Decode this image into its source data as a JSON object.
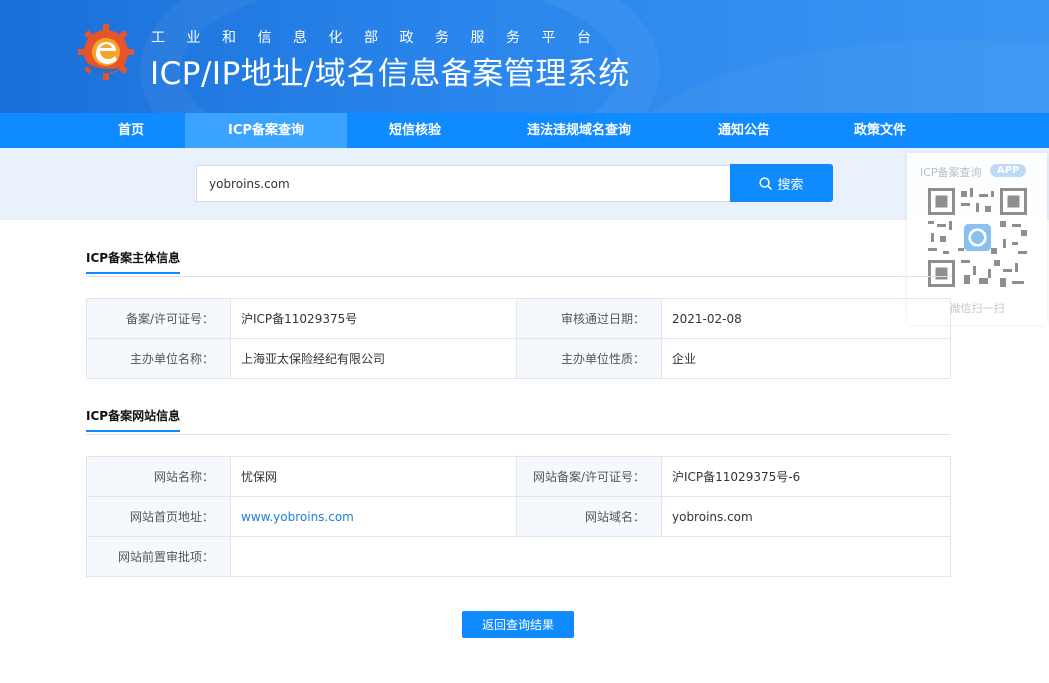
{
  "header": {
    "subtitle": "工业和信息化部政务服务平台",
    "title": "ICP/IP地址/域名信息备案管理系统"
  },
  "nav": {
    "items": [
      {
        "label": "首页"
      },
      {
        "label": "ICP备案查询",
        "active": true
      },
      {
        "label": "短信核验"
      },
      {
        "label": "违法违规域名查询"
      },
      {
        "label": "通知公告"
      },
      {
        "label": "政策文件"
      }
    ]
  },
  "search": {
    "value": "yobroins.com",
    "button_label": "搜索"
  },
  "qr_card": {
    "title": "ICP备案查询",
    "badge": "APP",
    "caption": "微信扫一扫"
  },
  "subject_section": {
    "title": "ICP备案主体信息",
    "rows": [
      {
        "label1": "备案/许可证号：",
        "value1": "沪ICP备11029375号",
        "label2": "审核通过日期：",
        "value2": "2021-02-08"
      },
      {
        "label1": "主办单位名称：",
        "value1": "上海亚太保险经纪有限公司",
        "label2": "主办单位性质：",
        "value2": "企业"
      }
    ]
  },
  "website_section": {
    "title": "ICP备案网站信息",
    "site_name_label": "网站名称：",
    "site_name": "忧保网",
    "site_license_label": "网站备案/许可证号：",
    "site_license": "沪ICP备11029375号-6",
    "homepage_label": "网站首页地址：",
    "homepage": "www.yobroins.com",
    "domain_label": "网站域名：",
    "domain": "yobroins.com",
    "pre_approval_label": "网站前置审批项：",
    "pre_approval": ""
  },
  "back_button_label": "返回查询结果",
  "colors": {
    "primary": "#0f8bff",
    "nav_active": "#3aa2ff",
    "search_band": "#e9f2fb",
    "label_bg": "#f5f9fd"
  }
}
